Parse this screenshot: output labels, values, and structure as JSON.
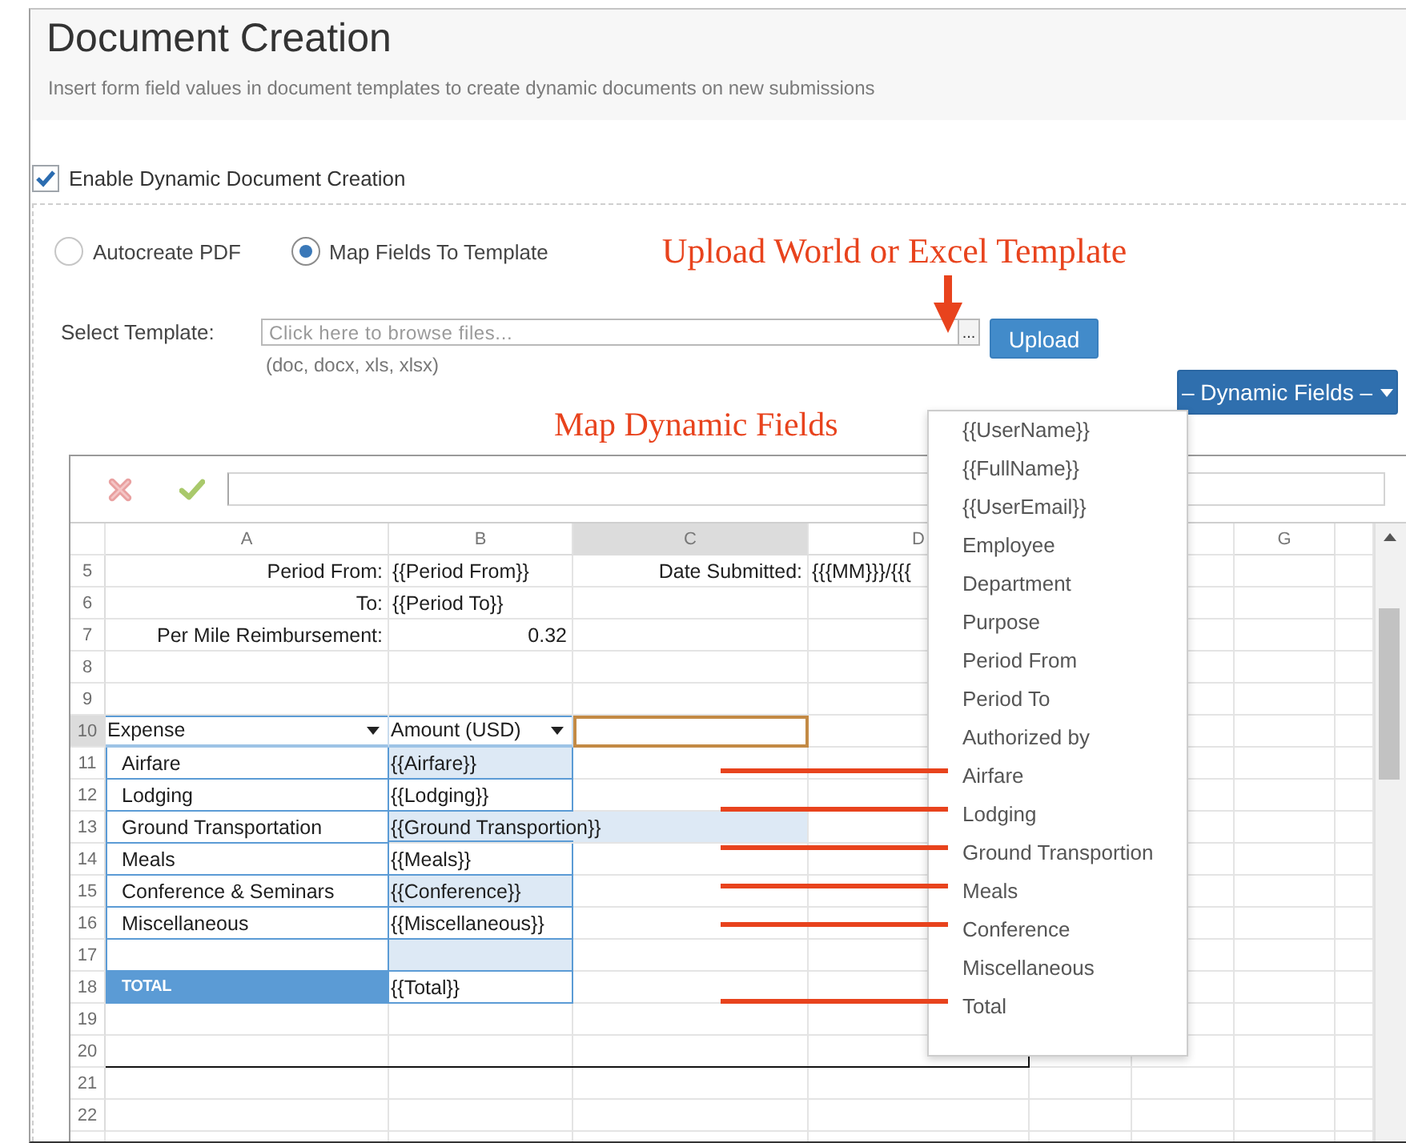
{
  "header": {
    "title": "Document Creation",
    "subtitle": "Insert form field values in document templates to create dynamic documents on new submissions"
  },
  "enable_option": {
    "label": "Enable Dynamic Document Creation",
    "checked": true
  },
  "mode_options": [
    {
      "label": "Autocreate PDF",
      "selected": false
    },
    {
      "label": "Map Fields To Template",
      "selected": true
    }
  ],
  "annotations": {
    "upload": "Upload World or Excel Template",
    "mapping": "Map Dynamic Fields"
  },
  "template": {
    "label": "Select Template:",
    "placeholder": "Click here to browse files...",
    "browse_button": "...",
    "upload_button": "Upload",
    "hint": "(doc, docx, xls, xlsx)"
  },
  "dynamic_fields_button": {
    "label": "– Dynamic Fields –",
    "expanded": true
  },
  "spreadsheet": {
    "columns": [
      {
        "label": "A",
        "selected": false
      },
      {
        "label": "B",
        "selected": false
      },
      {
        "label": "C",
        "selected": true
      },
      {
        "label": "D",
        "selected": false
      },
      {
        "label": "G",
        "selected": false
      }
    ],
    "rows": [
      {
        "number": "5",
        "selected": false,
        "cells": [
          {
            "kind": "label",
            "text": "Period From:"
          },
          {
            "kind": "value",
            "text": "{{Period From}}"
          },
          {
            "kind": "label",
            "text": "Date Submitted:"
          },
          {
            "kind": "value",
            "text": "{{{MM}}}/{{{"
          }
        ]
      },
      {
        "number": "6",
        "selected": false,
        "cells": [
          {
            "kind": "label",
            "text": "To:"
          },
          {
            "kind": "value",
            "text": "{{Period To}}"
          }
        ]
      },
      {
        "number": "7",
        "selected": false,
        "cells": [
          {
            "kind": "label",
            "text": "Per Mile Reimbursement:"
          },
          {
            "kind": "number",
            "text": "0.32"
          }
        ]
      },
      {
        "number": "8",
        "selected": false
      },
      {
        "number": "9",
        "selected": false
      },
      {
        "number": "10",
        "selected": true,
        "cells": [
          {
            "kind": "column_header",
            "text": "Expense"
          },
          {
            "kind": "column_header",
            "text": "Amount (USD)"
          }
        ]
      },
      {
        "number": "11",
        "selected": false,
        "cells": [
          {
            "kind": "item",
            "text": "Airfare"
          },
          {
            "kind": "field",
            "text": "{{Airfare}}",
            "shaded": true,
            "wide": false
          }
        ]
      },
      {
        "number": "12",
        "selected": false,
        "cells": [
          {
            "kind": "item",
            "text": "Lodging"
          },
          {
            "kind": "field",
            "text": "{{Lodging}}",
            "shaded": false,
            "wide": false
          }
        ]
      },
      {
        "number": "13",
        "selected": false,
        "cells": [
          {
            "kind": "item",
            "text": "Ground Transportation"
          },
          {
            "kind": "field",
            "text": "{{Ground Transportion}}",
            "shaded": true,
            "wide": true
          }
        ]
      },
      {
        "number": "14",
        "selected": false,
        "cells": [
          {
            "kind": "item",
            "text": "Meals"
          },
          {
            "kind": "field",
            "text": "{{Meals}}",
            "shaded": false,
            "wide": false
          }
        ]
      },
      {
        "number": "15",
        "selected": false,
        "cells": [
          {
            "kind": "item",
            "text": "Conference & Seminars"
          },
          {
            "kind": "field",
            "text": "{{Conference}}",
            "shaded": true,
            "wide": false
          }
        ]
      },
      {
        "number": "16",
        "selected": false,
        "cells": [
          {
            "kind": "item",
            "text": "Miscellaneous"
          },
          {
            "kind": "field",
            "text": "{{Miscellaneous}}",
            "shaded": false,
            "wide": false
          }
        ]
      },
      {
        "number": "17",
        "selected": false,
        "cells": [
          {
            "kind": "item"
          },
          {
            "kind": "field",
            "shaded": true,
            "wide": false
          }
        ]
      },
      {
        "number": "18",
        "selected": false,
        "cells": [
          {
            "kind": "total",
            "text": "TOTAL"
          },
          {
            "kind": "field",
            "text": "{{Total}}",
            "shaded": false,
            "wide": false
          }
        ]
      },
      {
        "number": "19",
        "selected": false
      },
      {
        "number": "20",
        "selected": false
      },
      {
        "number": "21",
        "selected": false
      },
      {
        "number": "22",
        "selected": false
      }
    ]
  },
  "dropdown": {
    "items": [
      {
        "label": "{{UserName}}",
        "linked": false
      },
      {
        "label": "{{FullName}}",
        "linked": false
      },
      {
        "label": "{{UserEmail}}",
        "linked": false
      },
      {
        "label": "Employee",
        "linked": false
      },
      {
        "label": "Department",
        "linked": false
      },
      {
        "label": "Purpose",
        "linked": false
      },
      {
        "label": "Period From",
        "linked": false
      },
      {
        "label": "Period To",
        "linked": false
      },
      {
        "label": "Authorized by",
        "linked": false
      },
      {
        "label": "Airfare",
        "linked": true
      },
      {
        "label": "Lodging",
        "linked": true
      },
      {
        "label": "Ground Transportion",
        "linked": true
      },
      {
        "label": "Meals",
        "linked": true
      },
      {
        "label": "Conference",
        "linked": true
      },
      {
        "label": "Miscellaneous",
        "linked": false
      },
      {
        "label": "Total",
        "linked": true
      }
    ]
  }
}
